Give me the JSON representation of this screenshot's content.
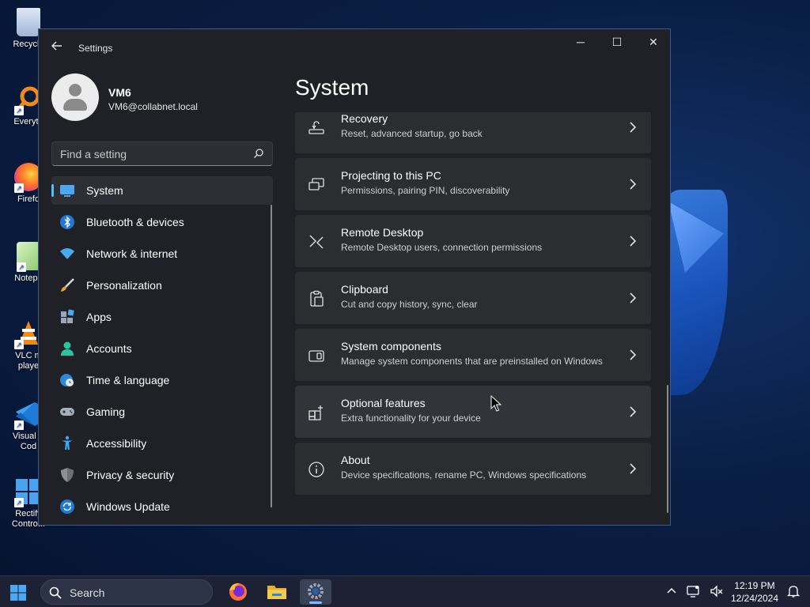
{
  "desktop": {
    "icons": [
      {
        "label": "Recycle"
      },
      {
        "label": "Everyth"
      },
      {
        "label": "Firefo"
      },
      {
        "label": "Notepa"
      },
      {
        "label": "VLC m\nplaye"
      },
      {
        "label": "Visual S\nCod"
      },
      {
        "label": "Rectify\nContro..."
      }
    ]
  },
  "window": {
    "app_title": "Settings",
    "controls": {
      "minimize": "─",
      "maximize": "☐",
      "close": "✕"
    }
  },
  "profile": {
    "name": "VM6",
    "email": "VM6@collabnet.local"
  },
  "search": {
    "placeholder": "Find a setting"
  },
  "nav": {
    "items": [
      {
        "label": "System",
        "icon": "monitor-icon",
        "active": true
      },
      {
        "label": "Bluetooth & devices",
        "icon": "bluetooth-icon"
      },
      {
        "label": "Network & internet",
        "icon": "wifi-icon"
      },
      {
        "label": "Personalization",
        "icon": "brush-icon"
      },
      {
        "label": "Apps",
        "icon": "apps-icon"
      },
      {
        "label": "Accounts",
        "icon": "person-icon"
      },
      {
        "label": "Time & language",
        "icon": "globe-clock-icon"
      },
      {
        "label": "Gaming",
        "icon": "gamepad-icon"
      },
      {
        "label": "Accessibility",
        "icon": "accessibility-icon"
      },
      {
        "label": "Privacy & security",
        "icon": "shield-icon"
      },
      {
        "label": "Windows Update",
        "icon": "update-icon"
      }
    ]
  },
  "main": {
    "title": "System",
    "cards": [
      {
        "title": "Recovery",
        "subtitle": "Reset, advanced startup, go back",
        "icon": "recovery-icon"
      },
      {
        "title": "Projecting to this PC",
        "subtitle": "Permissions, pairing PIN, discoverability",
        "icon": "projector-icon"
      },
      {
        "title": "Remote Desktop",
        "subtitle": "Remote Desktop users, connection permissions",
        "icon": "remote-desktop-icon"
      },
      {
        "title": "Clipboard",
        "subtitle": "Cut and copy history, sync, clear",
        "icon": "clipboard-icon"
      },
      {
        "title": "System components",
        "subtitle": "Manage system components that are preinstalled on Windows",
        "icon": "components-icon"
      },
      {
        "title": "Optional features",
        "subtitle": "Extra functionality for your device",
        "icon": "optional-features-icon"
      },
      {
        "title": "About",
        "subtitle": "Device specifications, rename PC, Windows specifications",
        "icon": "info-icon"
      }
    ]
  },
  "taskbar": {
    "search_label": "Search",
    "time": "12:19 PM",
    "date": "12/24/2024",
    "apps": [
      "firefox-icon",
      "file-explorer-icon",
      "settings-icon"
    ]
  },
  "colors": {
    "accent": "#4cc2ff",
    "window_bg": "#1f2126",
    "card_bg": "#2b2d31"
  }
}
